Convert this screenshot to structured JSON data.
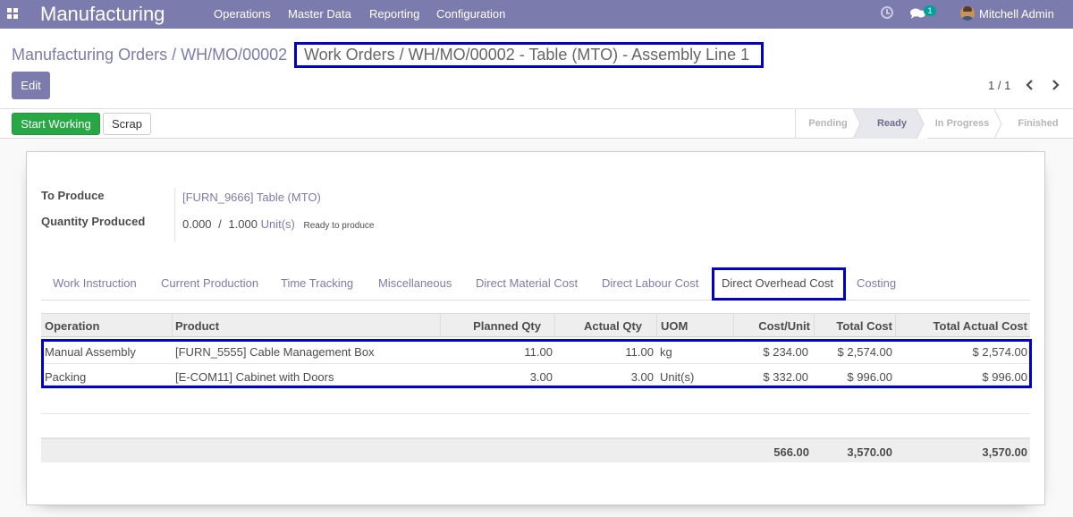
{
  "navbar": {
    "app_name": "Manufacturing",
    "menu": [
      "Operations",
      "Master Data",
      "Reporting",
      "Configuration"
    ],
    "chat_count": "1",
    "user_name": "Mitchell Admin",
    "color": "#7c7bad"
  },
  "breadcrumb": {
    "items": [
      "Manufacturing Orders",
      "WH/MO/00002"
    ],
    "separator": "/",
    "active": "Work Orders / WH/MO/00002 - Table (MTO) - Assembly Line 1"
  },
  "actions": {
    "edit_label": "Edit"
  },
  "pager": {
    "value": "1 / 1"
  },
  "statusbar": {
    "start_label": "Start Working",
    "scrap_label": "Scrap",
    "stages": [
      "Pending",
      "Ready",
      "In Progress",
      "Finished"
    ],
    "current_stage": "Ready"
  },
  "form": {
    "to_produce_label": "To Produce",
    "to_produce_value": "[FURN_9666] Table (MTO)",
    "qty_label": "Quantity Produced",
    "qty_done": "0.000",
    "qty_sep": "/",
    "qty_total": "1.000",
    "qty_uom": "Unit(s)",
    "qty_note": "Ready to produce"
  },
  "tabs": {
    "items": [
      "Work Instruction",
      "Current Production",
      "Time Tracking",
      "Miscellaneous",
      "Direct Material Cost",
      "Direct Labour Cost",
      "Direct Overhead Cost",
      "Costing"
    ],
    "active": "Direct Overhead Cost"
  },
  "table": {
    "columns": [
      "Operation",
      "Product",
      "Planned Qty",
      "Actual Qty",
      "UOM",
      "Cost/Unit",
      "Total Cost",
      "Total Actual Cost"
    ],
    "rows": [
      [
        "Manual Assembly",
        "[FURN_5555] Cable Management Box",
        "11.00",
        "11.00",
        "kg",
        "$ 234.00",
        "$ 2,574.00",
        "$ 2,574.00"
      ],
      [
        "Packing",
        "[E-COM11] Cabinet with Doors",
        "3.00",
        "3.00",
        "Unit(s)",
        "$ 332.00",
        "$ 996.00",
        "$ 996.00"
      ]
    ],
    "totals": {
      "cost_unit": "566.00",
      "total_cost": "3,570.00",
      "total_actual": "3,570.00"
    }
  }
}
